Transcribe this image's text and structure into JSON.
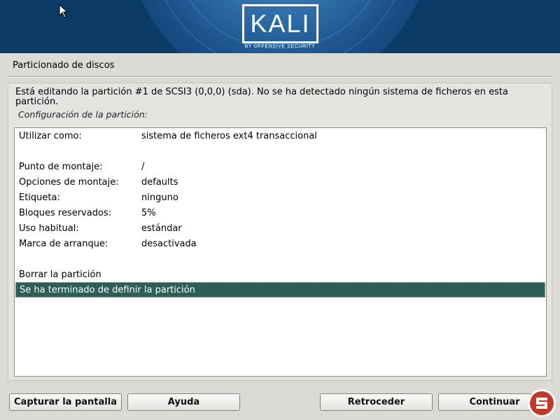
{
  "banner": {
    "logo_text": "KALI",
    "logo_subtitle": "BY OFFENSIVE SECURITY"
  },
  "page_title": "Particionado de discos",
  "intro": "Está editando la partición #1 de SCSI3 (0,0,0) (sda). No se ha detectado ningún sistema de ficheros en esta partición.",
  "subtitle": "Configuración de la partición:",
  "settings": [
    {
      "label": "Utilizar como:",
      "value": "sistema de ficheros ext4 transaccional"
    },
    {
      "label": "Punto de montaje:",
      "value": "/"
    },
    {
      "label": "Opciones de montaje:",
      "value": "defaults"
    },
    {
      "label": "Etiqueta:",
      "value": "ninguno"
    },
    {
      "label": "Bloques reservados:",
      "value": "5%"
    },
    {
      "label": "Uso habitual:",
      "value": "estándar"
    },
    {
      "label": "Marca de arranque:",
      "value": "desactivada"
    }
  ],
  "actions": [
    {
      "label": "Borrar la partición",
      "selected": false
    },
    {
      "label": "Se ha terminado de definir la partición",
      "selected": true
    }
  ],
  "buttons": {
    "screenshot": "Capturar la pantalla",
    "help": "Ayuda",
    "back": "Retroceder",
    "continue": "Continuar"
  },
  "colors": {
    "banner_bg": "#0a3a66",
    "selection_bg": "#2e5e57",
    "window_bg": "#dcdad5"
  },
  "icons": [
    "mouse-cursor-icon",
    "watermark-logo-icon"
  ]
}
